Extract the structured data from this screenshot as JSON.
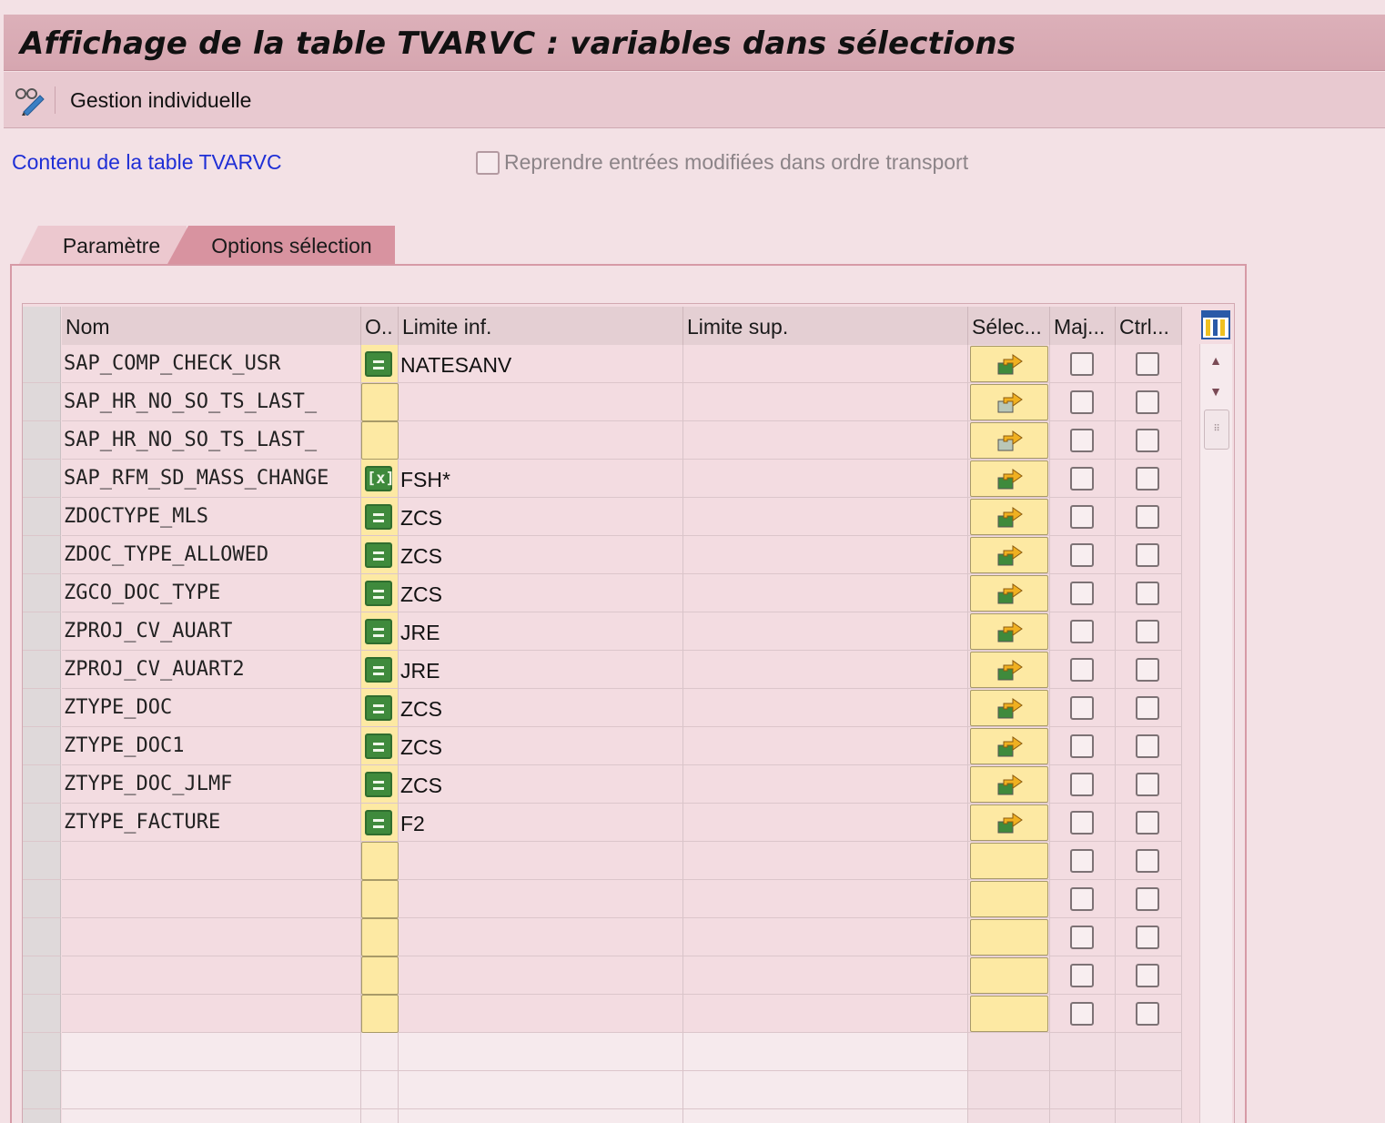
{
  "window": {
    "title": "Affichage de la table TVARVC : variables dans sélections"
  },
  "toolbar": {
    "gestion_label": "Gestion individuelle",
    "gestion_icon": "glasses-pencil-icon"
  },
  "header": {
    "content_link": "Contenu de la table TVARVC",
    "transport_checkbox_label": "Reprendre entrées modifiées dans ordre transport",
    "transport_checked": false
  },
  "tabs": [
    {
      "label": "Paramètre",
      "active": false
    },
    {
      "label": "Options sélection",
      "active": true
    }
  ],
  "table": {
    "columns": {
      "nom": "Nom",
      "option": "O..",
      "limite_inf": "Limite inf.",
      "limite_sup": "Limite sup.",
      "selection": "Sélec...",
      "maj": "Maj...",
      "ctrl": "Ctrl..."
    },
    "rows": [
      {
        "nom": "SAP_COMP_CHECK_USR",
        "option": "equal",
        "limite_inf": "NATESANV",
        "limite_sup": "",
        "sel_icon": "arrow-enabled",
        "maj": false,
        "ctrl": false
      },
      {
        "nom": "SAP_HR_NO_SO_TS_LAST_",
        "option": "",
        "limite_inf": "",
        "limite_sup": "",
        "sel_icon": "arrow-disabled",
        "maj": false,
        "ctrl": false
      },
      {
        "nom": "SAP_HR_NO_SO_TS_LAST_",
        "option": "",
        "limite_inf": "",
        "limite_sup": "",
        "sel_icon": "arrow-disabled",
        "maj": false,
        "ctrl": false
      },
      {
        "nom": "SAP_RFM_SD_MASS_CHANGE",
        "option": "pattern",
        "limite_inf": "FSH*",
        "limite_sup": "",
        "sel_icon": "arrow-enabled",
        "maj": false,
        "ctrl": false
      },
      {
        "nom": "ZDOCTYPE_MLS",
        "option": "equal",
        "limite_inf": "ZCS",
        "limite_sup": "",
        "sel_icon": "arrow-enabled",
        "maj": false,
        "ctrl": false
      },
      {
        "nom": "ZDOC_TYPE_ALLOWED",
        "option": "equal",
        "limite_inf": "ZCS",
        "limite_sup": "",
        "sel_icon": "arrow-enabled",
        "maj": false,
        "ctrl": false
      },
      {
        "nom": "ZGCO_DOC_TYPE",
        "option": "equal",
        "limite_inf": "ZCS",
        "limite_sup": "",
        "sel_icon": "arrow-enabled",
        "maj": false,
        "ctrl": false
      },
      {
        "nom": "ZPROJ_CV_AUART",
        "option": "equal",
        "limite_inf": "JRE",
        "limite_sup": "",
        "sel_icon": "arrow-enabled",
        "maj": false,
        "ctrl": false
      },
      {
        "nom": "ZPROJ_CV_AUART2",
        "option": "equal",
        "limite_inf": "JRE",
        "limite_sup": "",
        "sel_icon": "arrow-enabled",
        "maj": false,
        "ctrl": false
      },
      {
        "nom": "ZTYPE_DOC",
        "option": "equal",
        "limite_inf": "ZCS",
        "limite_sup": "",
        "sel_icon": "arrow-enabled",
        "maj": false,
        "ctrl": false
      },
      {
        "nom": "ZTYPE_DOC1",
        "option": "equal",
        "limite_inf": "ZCS",
        "limite_sup": "",
        "sel_icon": "arrow-enabled",
        "maj": false,
        "ctrl": false
      },
      {
        "nom": "ZTYPE_DOC_JLMF",
        "option": "equal",
        "limite_inf": "ZCS",
        "limite_sup": "",
        "sel_icon": "arrow-enabled",
        "maj": false,
        "ctrl": false
      },
      {
        "nom": "ZTYPE_FACTURE",
        "option": "equal",
        "limite_inf": "F2",
        "limite_sup": "",
        "sel_icon": "arrow-enabled",
        "maj": false,
        "ctrl": false
      }
    ],
    "empty_input_rows": 5,
    "empty_readonly_rows": 3
  },
  "colors": {
    "title_bg": "#dcb0b9",
    "toolbar_bg": "#e8c9d0",
    "input_yellow": "#fde9a3",
    "option_green": "#3f8a3c",
    "link_blue": "#1f2fd6"
  }
}
